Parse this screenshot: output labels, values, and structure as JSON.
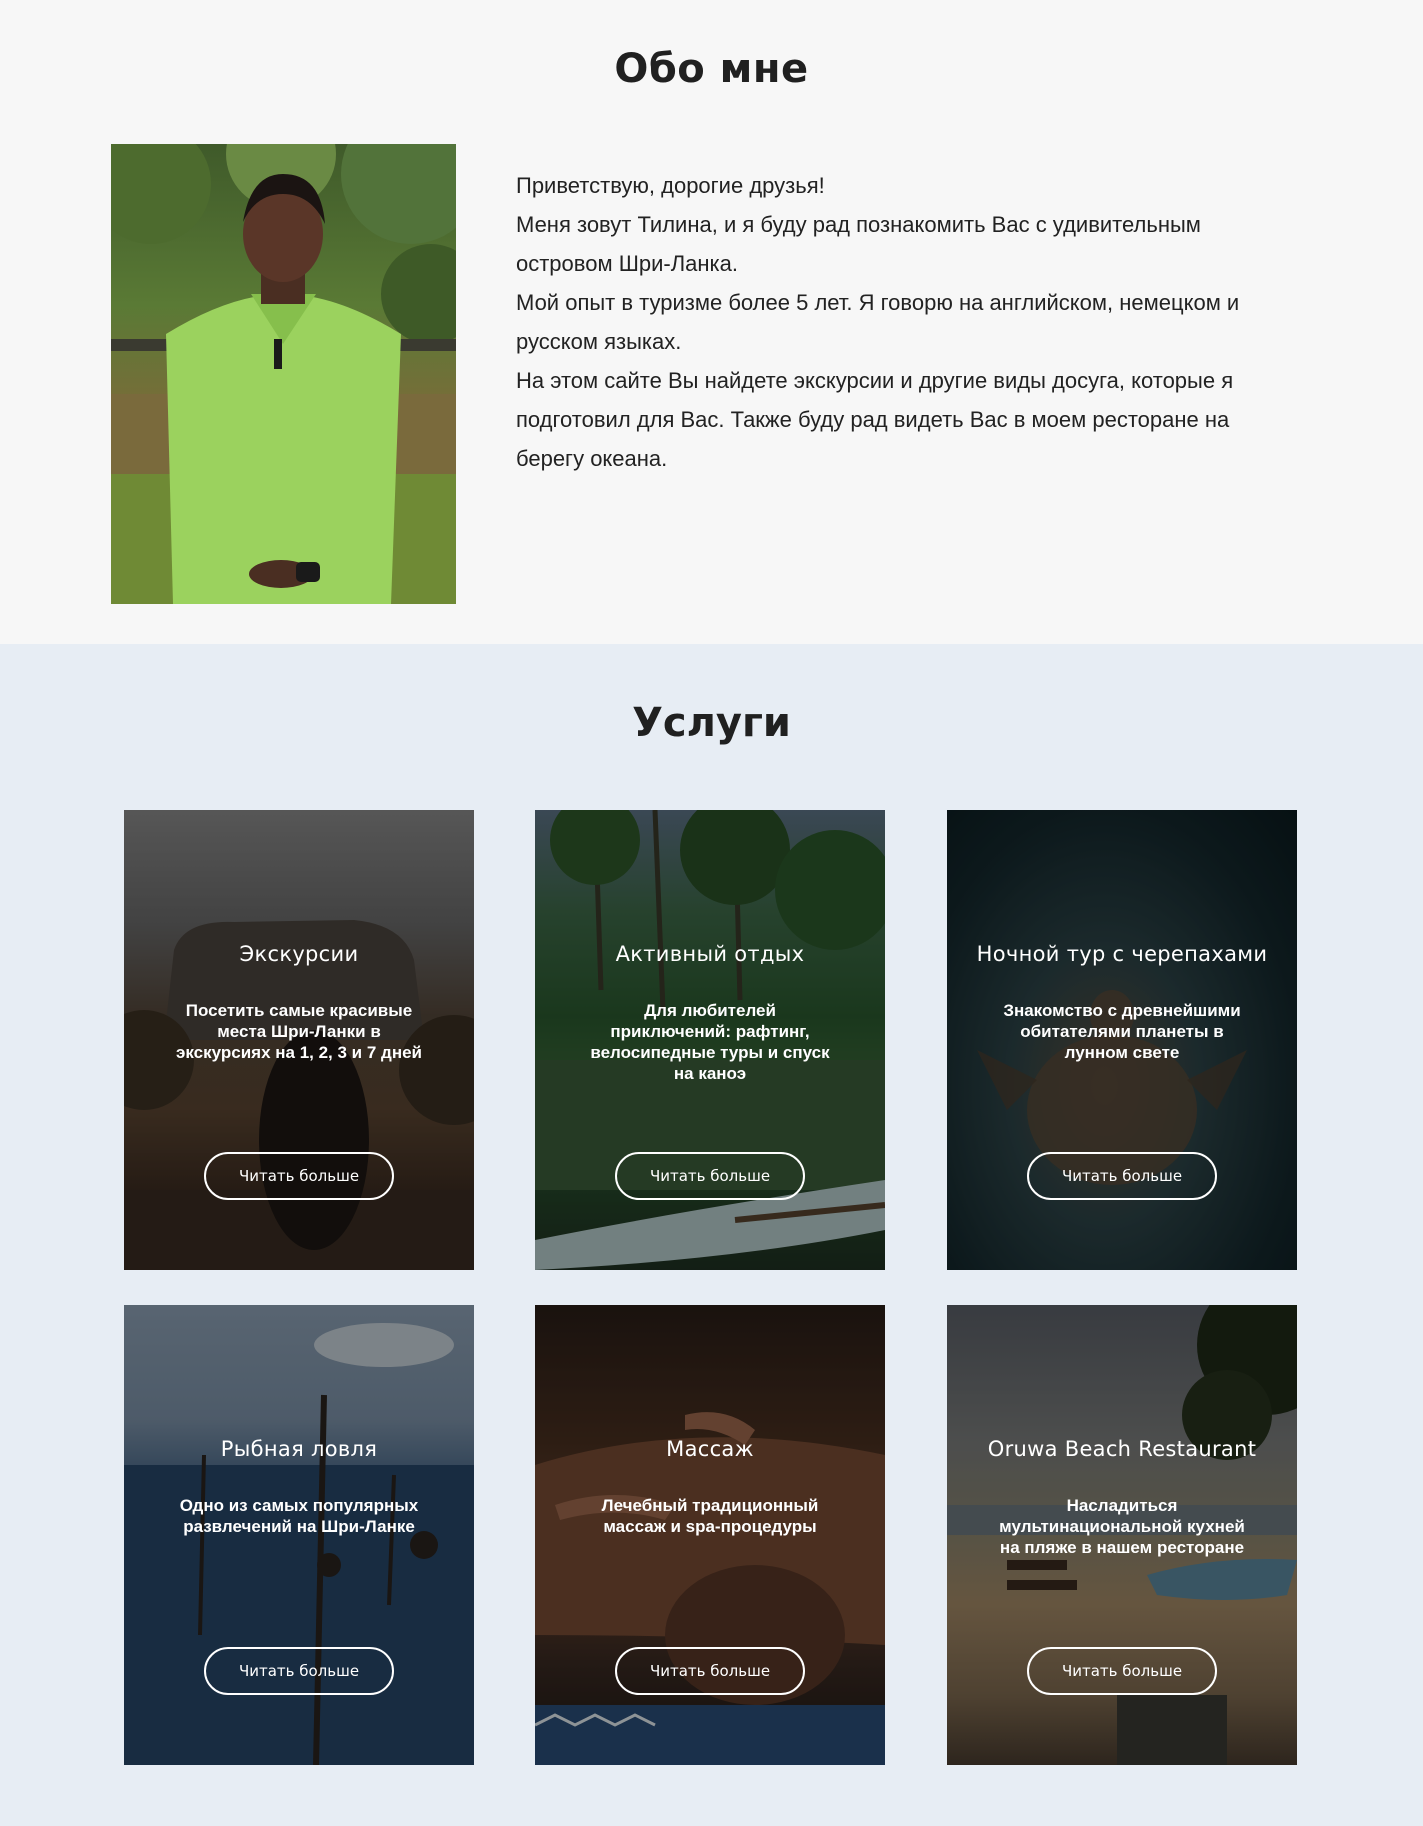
{
  "about": {
    "title": "Обо мне",
    "paragraphs": [
      "Приветствую, дорогие друзья!",
      "Меня зовут Тилина, и я буду рад познакомить Вас с удивительным островом Шри-Ланка.",
      "Мой опыт в туризме более 5 лет. Я говорю на английском, немецком и русском языках.",
      "На этом сайте Вы найдете экскурсии и другие виды досуга, которые я подготовил для Вас. Также буду рад видеть Вас в моем ресторане на берегу океана."
    ]
  },
  "services": {
    "title": "Услуги",
    "cards": [
      {
        "title": "Экскурсии",
        "description": "Посетить самые красивые места Шри-Ланки в экскурсиях на 1, 2, 3 и 7 дней",
        "button": "Читать больше"
      },
      {
        "title": "Активный отдых",
        "description": "Для любителей приключений: рафтинг, велосипедные туры и спуск на каноэ",
        "button": "Читать больше"
      },
      {
        "title": "Ночной тур с черепахами",
        "description": "Знакомство с древнейшими обитателями планеты в лунном свете",
        "button": "Читать больше"
      },
      {
        "title": "Рыбная ловля",
        "description": "Одно из самых популярных развлечений на Шри-Ланке",
        "button": "Читать больше"
      },
      {
        "title": "Массаж",
        "description": "Лечебный традиционный массаж и spa-процедуры",
        "button": "Читать больше"
      },
      {
        "title": "Oruwa Beach Restaurant",
        "description": "Насладиться мультинациональной кухней на пляже в нашем ресторане",
        "button": "Читать больше"
      }
    ]
  }
}
